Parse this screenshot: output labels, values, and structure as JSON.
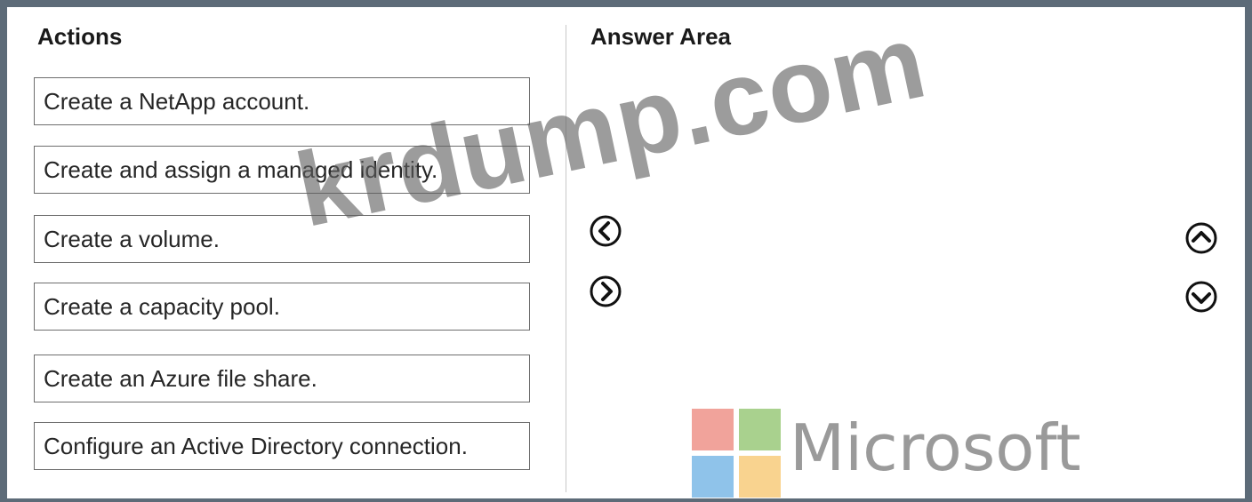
{
  "actions": {
    "title": "Actions",
    "items": [
      "Create a NetApp account.",
      "Create and assign a managed identity.",
      "Create a volume.",
      "Create a capacity pool.",
      "Create an Azure file share.",
      "Configure an Active Directory connection."
    ]
  },
  "answer_area": {
    "title": "Answer Area"
  },
  "controls": {
    "move_left_icon": "chevron-left-circle",
    "move_right_icon": "chevron-right-circle",
    "move_up_icon": "chevron-up-circle",
    "move_down_icon": "chevron-down-circle"
  },
  "watermark": {
    "text": "krdump.com"
  },
  "logo": {
    "text": "Microsoft",
    "colors": [
      "#f1a39b",
      "#a9d18e",
      "#8fc3ea",
      "#f9d38f"
    ]
  }
}
